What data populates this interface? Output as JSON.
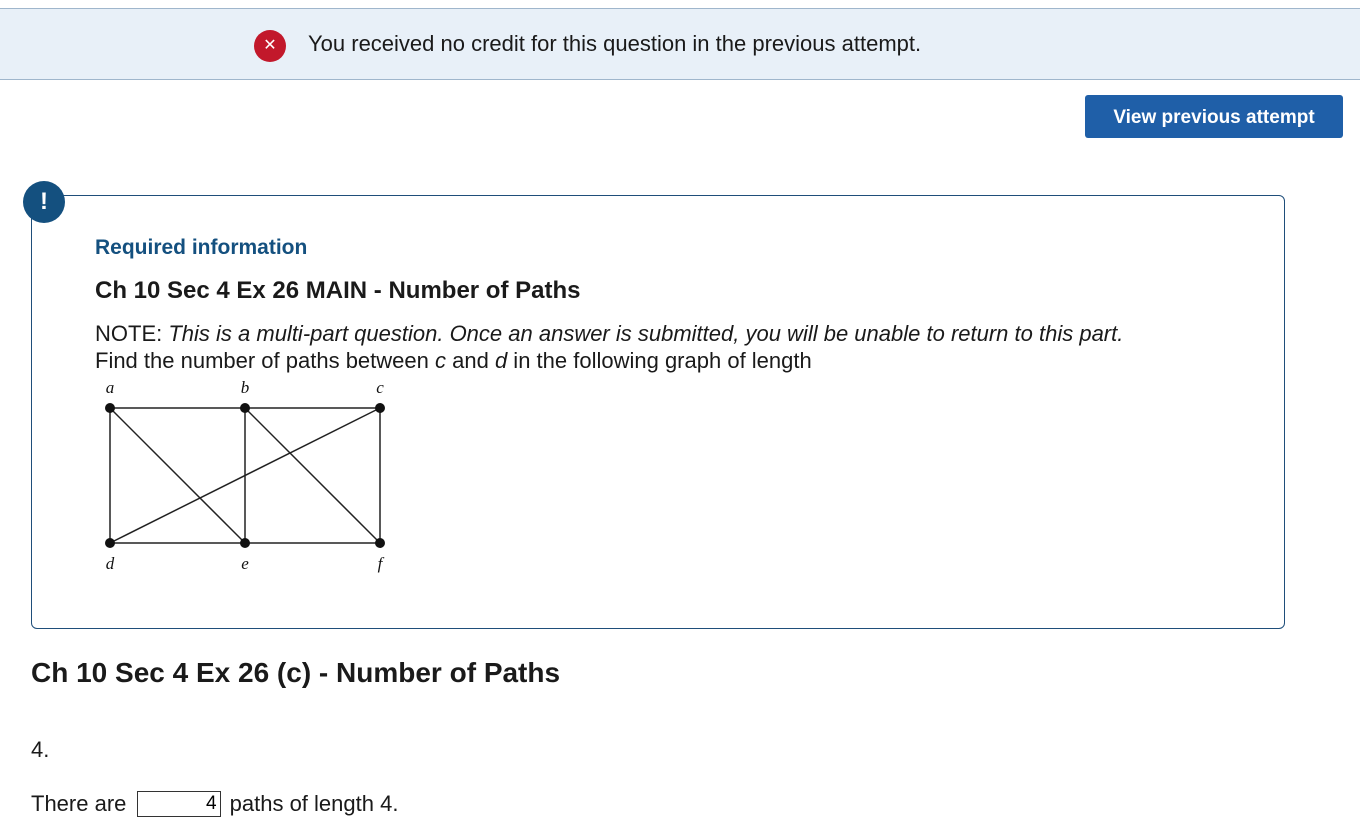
{
  "banner": {
    "icon": "error-x-icon",
    "message": "You received no credit for this question in the previous attempt.",
    "icon_color": "#c2182b"
  },
  "view_previous_attempt_label": "View previous attempt",
  "required_info": {
    "icon": "exclamation-icon",
    "heading": "Required information",
    "title": "Ch 10 Sec 4 Ex 26 MAIN - Number of Paths",
    "note_prefix": "NOTE: ",
    "note_italic": "This is a multi-part question. Once an answer is submitted, you will be unable to return to this part.",
    "find_text_1": "Find the number of paths between ",
    "var_c": "c",
    "find_text_2": " and ",
    "var_d": "d",
    "find_text_3": " in the following graph of length",
    "graph": {
      "vertices": [
        "a",
        "b",
        "c",
        "d",
        "e",
        "f"
      ],
      "edges": [
        [
          "a",
          "b"
        ],
        [
          "b",
          "c"
        ],
        [
          "a",
          "d"
        ],
        [
          "b",
          "e"
        ],
        [
          "c",
          "f"
        ],
        [
          "d",
          "e"
        ],
        [
          "e",
          "f"
        ],
        [
          "a",
          "e"
        ],
        [
          "b",
          "f"
        ],
        [
          "c",
          "d"
        ]
      ]
    }
  },
  "part": {
    "title": "Ch 10 Sec 4 Ex 26 (c) - Number of Paths",
    "number": "4.",
    "answer_prefix": "There are",
    "answer_value": "4",
    "answer_suffix": "paths of length 4."
  },
  "colors": {
    "banner_bg": "#e8f0f8",
    "button_bg": "#1f5fa8",
    "heading_blue": "#14507f"
  }
}
